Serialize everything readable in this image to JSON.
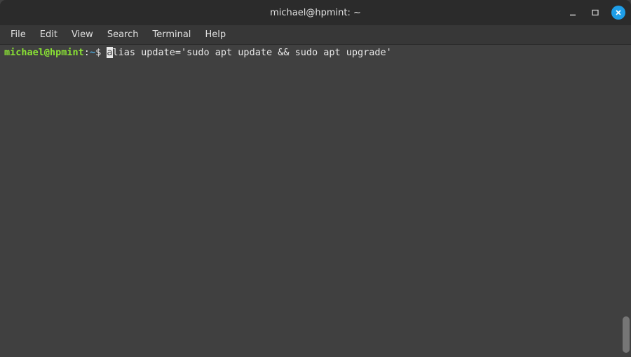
{
  "window": {
    "title": "michael@hpmint: ~"
  },
  "menubar": {
    "items": [
      "File",
      "Edit",
      "View",
      "Search",
      "Terminal",
      "Help"
    ]
  },
  "terminal": {
    "prompt": {
      "user_host": "michael@hpmint",
      "sep1": ":",
      "path": "~",
      "symbol": "$"
    },
    "cursor_char": "a",
    "command_rest": "lias update='sudo apt update && sudo apt upgrade'"
  }
}
